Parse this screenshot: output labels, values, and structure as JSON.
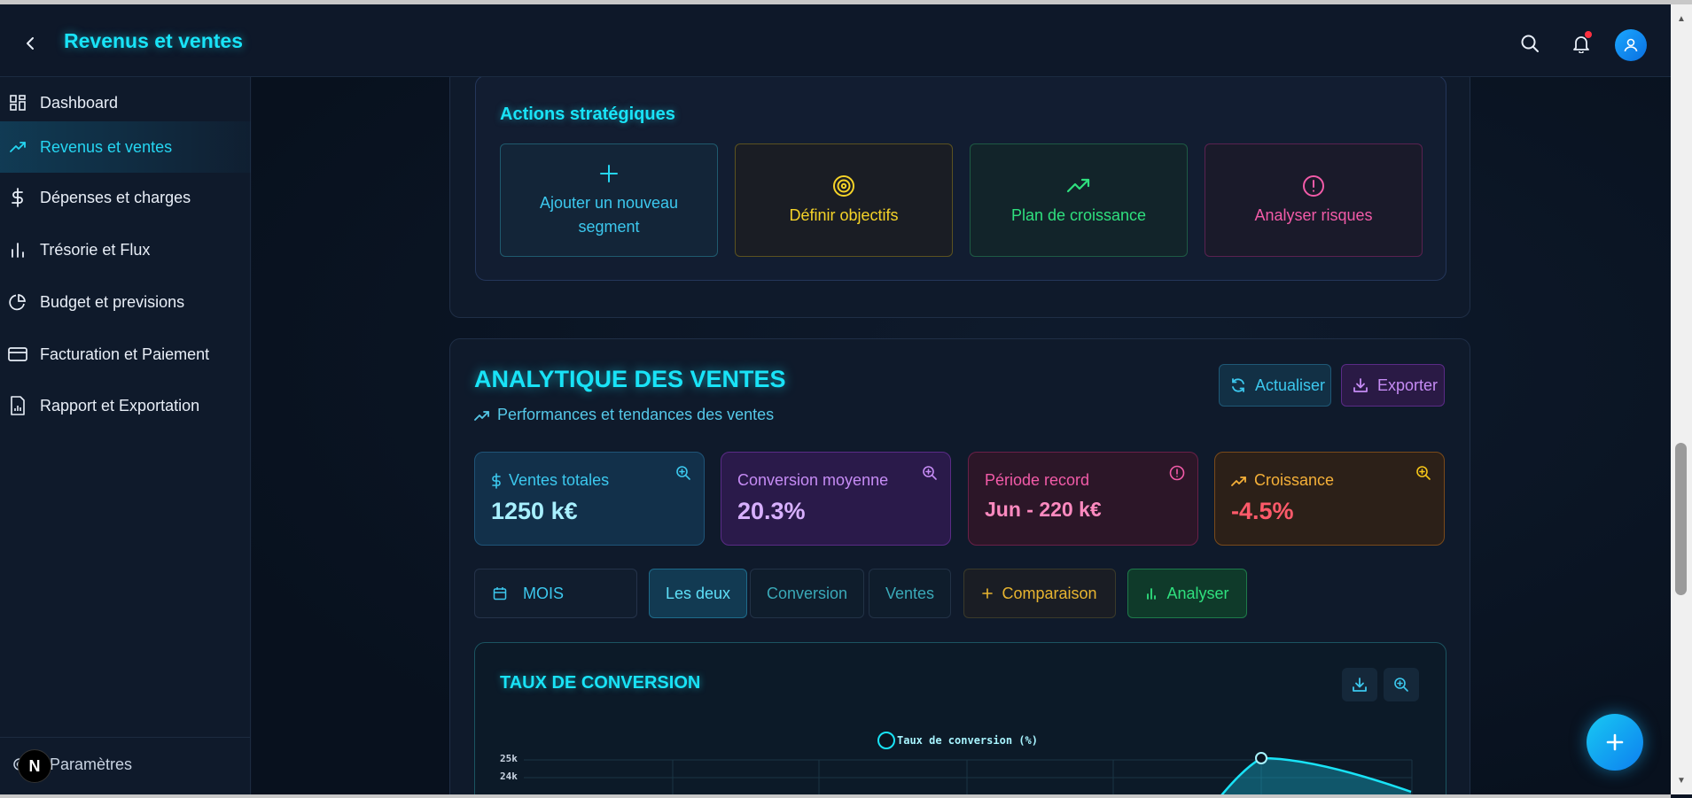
{
  "header": {
    "title": "Revenus et ventes"
  },
  "sidebar": {
    "items": [
      {
        "label": "Dashboard",
        "icon": "dashboard-grid-icon"
      },
      {
        "label": "Revenus et ventes",
        "icon": "trending-up-icon",
        "active": true
      },
      {
        "label": "Dépenses et charges",
        "icon": "dollar-icon"
      },
      {
        "label": "Trésorie et Flux",
        "icon": "bar-chart-icon"
      },
      {
        "label": "Budget et previsions",
        "icon": "pie-chart-icon"
      },
      {
        "label": "Facturation et Paiement",
        "icon": "credit-card-icon"
      },
      {
        "label": "Rapport et Exportation",
        "icon": "report-icon"
      }
    ],
    "settings_label": "Paramètres"
  },
  "strategic": {
    "title": "Actions stratégiques",
    "actions": [
      {
        "label": "Ajouter un nouveau segment",
        "color": "#25d6f2"
      },
      {
        "label": "Définir objectifs",
        "color": "#f5d328"
      },
      {
        "label": "Plan de croissance",
        "color": "#2fe07e"
      },
      {
        "label": "Analyser risques",
        "color": "#f25ba8"
      }
    ]
  },
  "analytics": {
    "title": "ANALYTIQUE DES VENTES",
    "subtitle": "Performances et tendances des ventes",
    "refresh_label": "Actualiser",
    "export_label": "Exporter",
    "kpis": [
      {
        "label": "Ventes totales",
        "value": "1250 k€"
      },
      {
        "label": "Conversion moyenne",
        "value": "20.3%"
      },
      {
        "label": "Période record",
        "value": "Jun - 220 k€"
      },
      {
        "label": "Croissance",
        "value": "-4.5%"
      }
    ],
    "period_select": "MOIS",
    "view_tabs": [
      "Les deux",
      "Conversion",
      "Ventes"
    ],
    "compare_label": "Comparaison",
    "analyze_label": "Analyser"
  },
  "chart": {
    "title": "TAUX DE CONVERSION",
    "legend": "Taux de conversion (%)",
    "ytick_labels": [
      "25k",
      "24k"
    ]
  },
  "chart_data": {
    "type": "area",
    "title": "TAUX DE CONVERSION",
    "series": [
      {
        "name": "Taux de conversion (%)"
      }
    ],
    "y_ticks": [
      "25k",
      "24k"
    ],
    "note": "Chart partially visible; only top of curve shown"
  },
  "colors": {
    "accent": "#19e3f7",
    "background": "#0b1424",
    "danger": "#ff5a6a"
  }
}
